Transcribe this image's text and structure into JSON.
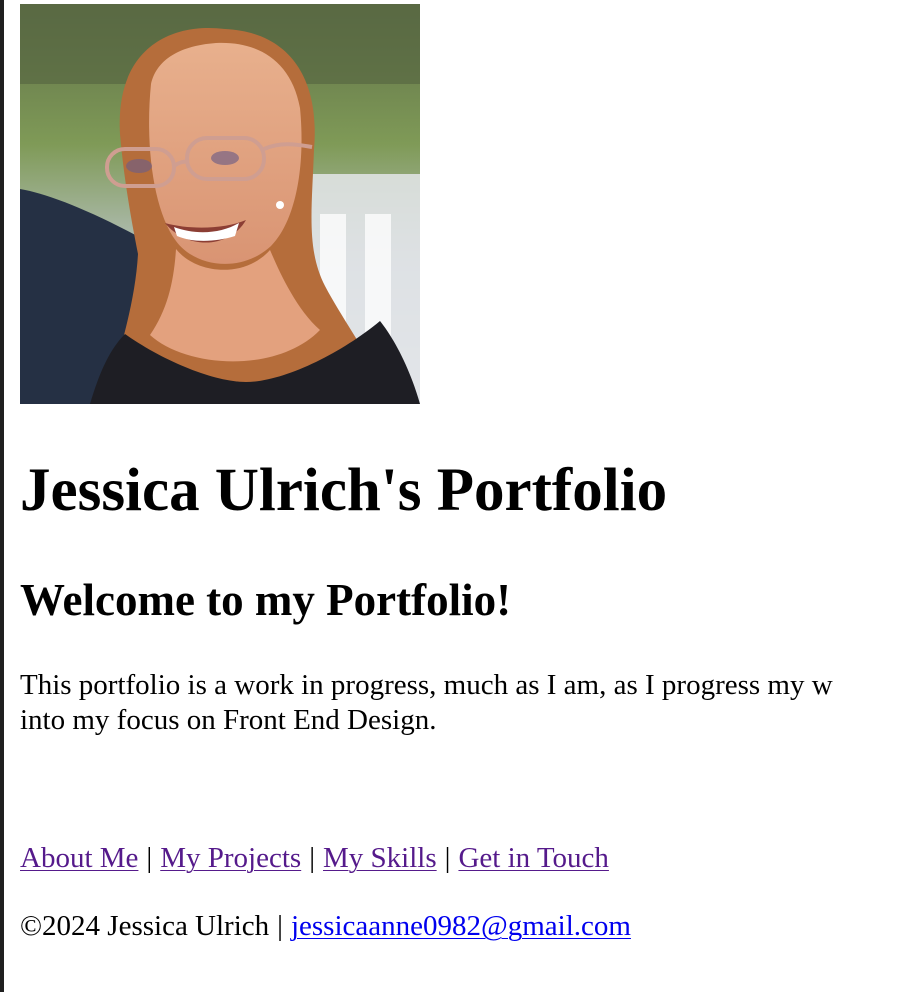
{
  "profile": {
    "image_label": "Jessica Ulrich"
  },
  "header": {
    "title": "Jessica Ulrich's Portfolio",
    "subtitle": "Welcome to my Portfolio!"
  },
  "intro": {
    "line1": "This portfolio is a work in progress, much as I am, as I progress my w",
    "line2": "into my focus on Front End Design."
  },
  "nav": {
    "about": "About Me",
    "projects": "My Projects",
    "skills": "My Skills",
    "contact": "Get in Touch",
    "separator": "|"
  },
  "footer": {
    "copyright": "©2024 Jessica Ulrich",
    "separator": "|",
    "email": "jessicaanne0982@gmail.com"
  },
  "colors": {
    "visited_link": "#551a8b",
    "link": "#0000ee",
    "text": "#000000"
  }
}
